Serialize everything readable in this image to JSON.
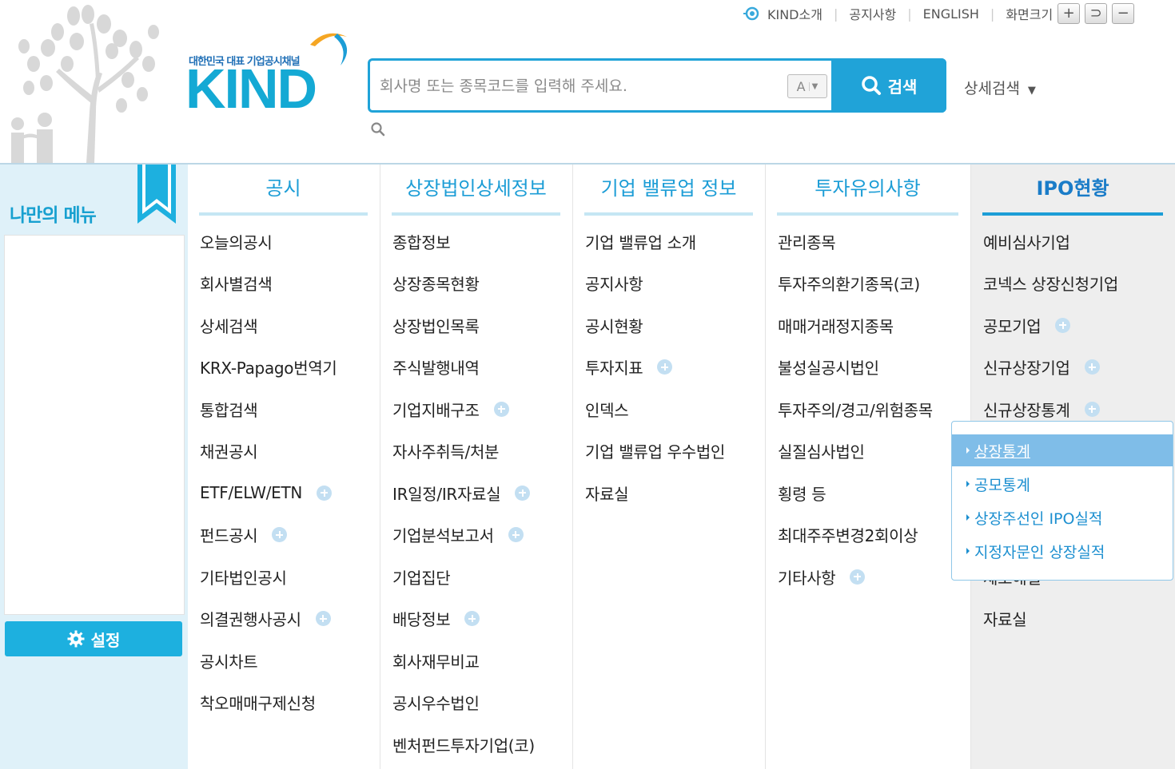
{
  "header": {
    "logo_tagline": "대한민국 대표 기업공시채널",
    "logo_text": "KIND",
    "util_links": [
      "KIND소개",
      "공지사항",
      "ENGLISH",
      "화면크기"
    ],
    "font_buttons": [
      "+",
      "⊃",
      "−"
    ]
  },
  "search": {
    "placeholder": "회사명 또는 종목코드를 입력해 주세요.",
    "autocomplete_label": "A",
    "autocomplete_arrow": "▼",
    "button_label": "검색",
    "advanced_label": "상세검색",
    "advanced_arrow": "▼"
  },
  "mymenu": {
    "title": "나만의 메뉴",
    "settings_label": "설정"
  },
  "columns": [
    {
      "title": "공시",
      "items": [
        {
          "label": "오늘의공시",
          "plus": false
        },
        {
          "label": "회사별검색",
          "plus": false
        },
        {
          "label": "상세검색",
          "plus": false
        },
        {
          "label": "KRX-Papago번역기",
          "plus": false
        },
        {
          "label": "통합검색",
          "plus": false
        },
        {
          "label": "채권공시",
          "plus": false
        },
        {
          "label": "ETF/ELW/ETN",
          "plus": true
        },
        {
          "label": "펀드공시",
          "plus": true
        },
        {
          "label": "기타법인공시",
          "plus": false
        },
        {
          "label": "의결권행사공시",
          "plus": true
        },
        {
          "label": "공시차트",
          "plus": false
        },
        {
          "label": "착오매매구제신청",
          "plus": false
        }
      ]
    },
    {
      "title": "상장법인상세정보",
      "items": [
        {
          "label": "종합정보",
          "plus": false
        },
        {
          "label": "상장종목현황",
          "plus": false
        },
        {
          "label": "상장법인목록",
          "plus": false
        },
        {
          "label": "주식발행내역",
          "plus": false
        },
        {
          "label": "기업지배구조",
          "plus": true
        },
        {
          "label": "자사주취득/처분",
          "plus": false
        },
        {
          "label": "IR일정/IR자료실",
          "plus": true
        },
        {
          "label": "기업분석보고서",
          "plus": true
        },
        {
          "label": "기업집단",
          "plus": false
        },
        {
          "label": "배당정보",
          "plus": true
        },
        {
          "label": "회사재무비교",
          "plus": false
        },
        {
          "label": "공시우수법인",
          "plus": false
        },
        {
          "label": "벤처펀드투자기업(코)",
          "plus": false
        }
      ]
    },
    {
      "title": "기업 밸류업 정보",
      "items": [
        {
          "label": "기업 밸류업 소개",
          "plus": false
        },
        {
          "label": "공지사항",
          "plus": false
        },
        {
          "label": "공시현황",
          "plus": false
        },
        {
          "label": "투자지표",
          "plus": true
        },
        {
          "label": "인덱스",
          "plus": false
        },
        {
          "label": "기업 밸류업 우수법인",
          "plus": false
        },
        {
          "label": "자료실",
          "plus": false
        }
      ]
    },
    {
      "title": "투자유의사항",
      "items": [
        {
          "label": "관리종목",
          "plus": false
        },
        {
          "label": "투자주의환기종목(코)",
          "plus": false
        },
        {
          "label": "매매거래정지종목",
          "plus": false
        },
        {
          "label": "불성실공시법인",
          "plus": false
        },
        {
          "label": "투자주의/경고/위험종목",
          "plus": false
        },
        {
          "label": "실질심사법인",
          "plus": false
        },
        {
          "label": "횡령 등",
          "plus": false
        },
        {
          "label": "최대주주변경2회이상",
          "plus": false
        },
        {
          "label": "기타사항",
          "plus": true
        }
      ]
    },
    {
      "title": "IPO현황",
      "items": [
        {
          "label": "예비심사기업",
          "plus": false
        },
        {
          "label": "코넥스 상장신청기업",
          "plus": false
        },
        {
          "label": "공모기업",
          "plus": true
        },
        {
          "label": "신규상장기업",
          "plus": true
        },
        {
          "label": "신규상장통계",
          "plus": true
        },
        {
          "label": "",
          "plus": false
        },
        {
          "label": "",
          "plus": false
        },
        {
          "label": "",
          "plus": false
        },
        {
          "label": "제도해설",
          "plus": false
        },
        {
          "label": "자료실",
          "plus": false
        }
      ]
    }
  ],
  "submenu": {
    "items": [
      "상장통계",
      "공모통계",
      "상장주선인 IPO실적",
      "지정자문인 상장실적"
    ],
    "active_index": 0
  }
}
